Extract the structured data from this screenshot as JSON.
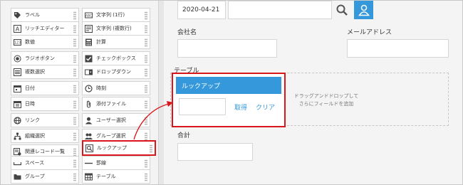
{
  "palette": {
    "left": [
      {
        "label": "ラベル",
        "icon": "tag-icon"
      },
      {
        "label": "リッチエディター",
        "icon": "rich-editor-icon"
      },
      {
        "label": "数値",
        "icon": "number-icon"
      },
      {
        "label": "ラジオボタン",
        "icon": "radio-icon"
      },
      {
        "label": "複数選択",
        "icon": "multi-select-icon"
      },
      {
        "label": "日付",
        "icon": "calendar-icon"
      },
      {
        "label": "日時",
        "icon": "datetime-icon"
      },
      {
        "label": "リンク",
        "icon": "link-icon"
      },
      {
        "label": "組織選択",
        "icon": "organization-icon"
      },
      {
        "label": "関連レコード一覧",
        "icon": "related-records-icon"
      },
      {
        "label": "スペース",
        "icon": "space-icon"
      },
      {
        "label": "グループ",
        "icon": "group-folder-icon"
      }
    ],
    "right": [
      {
        "label": "文字列 (1行)",
        "icon": "text-single-icon"
      },
      {
        "label": "文字列 (複数行)",
        "icon": "text-multi-icon"
      },
      {
        "label": "計算",
        "icon": "calculator-icon"
      },
      {
        "label": "チェックボックス",
        "icon": "checkbox-icon"
      },
      {
        "label": "ドロップダウン",
        "icon": "dropdown-icon"
      },
      {
        "label": "時刻",
        "icon": "clock-icon"
      },
      {
        "label": "添付ファイル",
        "icon": "attachment-icon"
      },
      {
        "label": "ユーザー選択",
        "icon": "user-icon"
      },
      {
        "label": "グループ選択",
        "icon": "group-users-icon"
      },
      {
        "label": "ルックアップ",
        "icon": "lookup-icon"
      },
      {
        "label": "罫線",
        "icon": "rule-line-icon"
      },
      {
        "label": "テーブル",
        "icon": "table-icon"
      }
    ]
  },
  "form": {
    "date_value": "2020-04-21",
    "company_label": "会社名",
    "email_label": "メールアドレス",
    "table_label": "テーブル",
    "drop_hint_line1": "ドラッグアンドドロップして",
    "drop_hint_line2": "さらにフィールドを追加",
    "total_label": "合計"
  },
  "lookup": {
    "title": "ルックアップ",
    "fetch_label": "取得",
    "clear_label": "クリア"
  },
  "colors": {
    "accent": "#3498db",
    "highlight": "#d9161c"
  }
}
